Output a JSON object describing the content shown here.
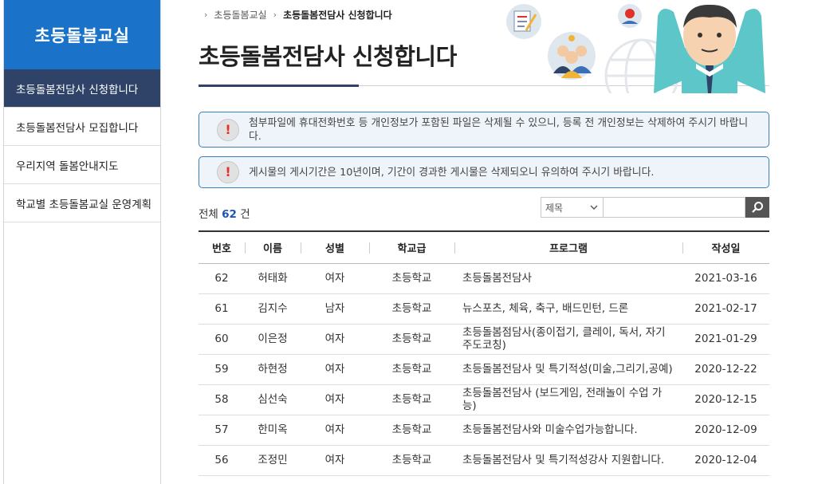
{
  "sidebar": {
    "title": "초등돌봄교실",
    "items": [
      {
        "label": "초등돌봄전담사 신청합니다",
        "active": true
      },
      {
        "label": "초등돌봄전담사 모집합니다",
        "active": false
      },
      {
        "label": "우리지역 돌봄안내지도",
        "active": false
      },
      {
        "label": "학교별 초등돌봄교실 운영계획",
        "active": false
      }
    ]
  },
  "breadcrumb": {
    "parent": "초등돌봄교실",
    "current": "초등돌봄전담사 신청합니다"
  },
  "page_title": "초등돌봄전담사 신청합니다",
  "notices": [
    "첨부파일에 휴대전화번호 등 개인정보가 포함된 파일은 삭제될 수 있으니, 등록 전 개인정보는 삭제하여 주시기 바랍니다.",
    "게시물의 게시기간은 10년이며, 기간이 경과한 게시물은 삭제되오니 유의하여 주시기 바랍니다."
  ],
  "total": {
    "prefix": "전체",
    "count": "62",
    "suffix": "건"
  },
  "search": {
    "select_value": "제목",
    "input_value": ""
  },
  "colors": {
    "sidebar_head": "#1a73c8",
    "active": "#2f4369",
    "notice_border": "#3b7fb8",
    "notice_bg": "#eef4fa",
    "count": "#1a56b5"
  },
  "table": {
    "headers": [
      "번호",
      "이름",
      "성별",
      "학교급",
      "프로그램",
      "작성일"
    ],
    "rows": [
      {
        "no": "62",
        "name": "허태화",
        "gender": "여자",
        "level": "초등학교",
        "program": "초등돌봄전담사",
        "date": "2021-03-16"
      },
      {
        "no": "61",
        "name": "김지수",
        "gender": "남자",
        "level": "초등학교",
        "program": "뉴스포츠, 체육, 축구, 배드민턴, 드론",
        "date": "2021-02-17"
      },
      {
        "no": "60",
        "name": "이은정",
        "gender": "여자",
        "level": "초등학교",
        "program": "초등돌봄점담사(종이접기, 클레이, 독서, 자기주도코칭)",
        "date": "2021-01-29"
      },
      {
        "no": "59",
        "name": "하현정",
        "gender": "여자",
        "level": "초등학교",
        "program": "초등돌봄전담사 및 특기적성(미술,그리기,공예)",
        "date": "2020-12-22"
      },
      {
        "no": "58",
        "name": "심선숙",
        "gender": "여자",
        "level": "초등학교",
        "program": "초등돌봄전담사 (보드게임, 전래놀이 수업 가능)",
        "date": "2020-12-15"
      },
      {
        "no": "57",
        "name": "한미옥",
        "gender": "여자",
        "level": "초등학교",
        "program": "초등돌봄전담사와 미술수업가능합니다.",
        "date": "2020-12-09"
      },
      {
        "no": "56",
        "name": "조정민",
        "gender": "여자",
        "level": "초등학교",
        "program": "초등돌봄전담사 및 특기적성강사 지원합니다.",
        "date": "2020-12-04"
      }
    ]
  }
}
